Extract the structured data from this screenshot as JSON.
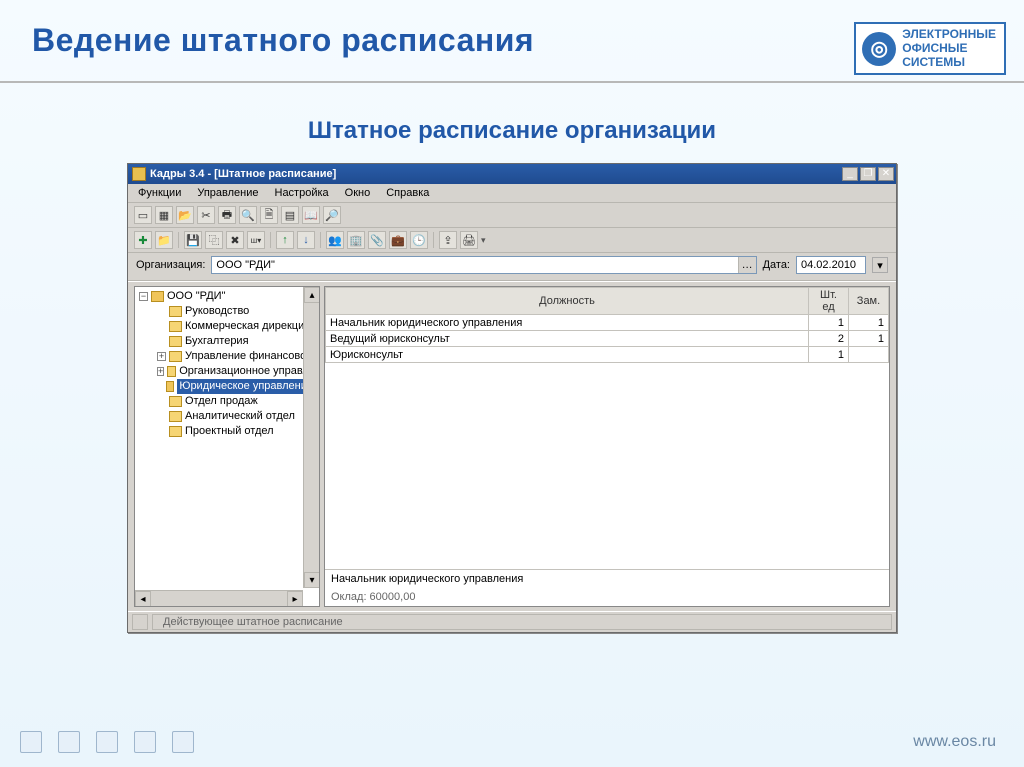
{
  "slide": {
    "title": "Ведение штатного расписания",
    "subtitle": "Штатное расписание организации",
    "logo_lines": [
      "ЭЛЕКТРОННЫЕ",
      "ОФИСНЫЕ",
      "СИСТЕМЫ"
    ],
    "footer_url": "www.eos.ru"
  },
  "window": {
    "title": "Кадры 3.4 - [Штатное расписание]",
    "menu": [
      "Функции",
      "Управление",
      "Настройка",
      "Окно",
      "Справка"
    ],
    "orgrow": {
      "org_label": "Организация:",
      "org_value": "ООО \"РДИ\"",
      "date_label": "Дата:",
      "date_value": "04.02.2010"
    },
    "tree": {
      "root": "ООО \"РДИ\"",
      "children": [
        {
          "label": "Руководство",
          "expand": null
        },
        {
          "label": "Коммерческая дирекция",
          "expand": null
        },
        {
          "label": "Бухгалтерия",
          "expand": null
        },
        {
          "label": "Управление финансовов",
          "expand": "closed"
        },
        {
          "label": "Организационное управле",
          "expand": "closed"
        },
        {
          "label": "Юридическое управление",
          "expand": null,
          "selected": true
        },
        {
          "label": "Отдел продаж",
          "expand": null
        },
        {
          "label": "Аналитический отдел",
          "expand": null
        },
        {
          "label": "Проектный отдел",
          "expand": null
        }
      ]
    },
    "table": {
      "headers": {
        "position": "Должность",
        "units": "Шт. ед",
        "subs": "Зам."
      },
      "rows": [
        {
          "position": "Начальник юридического управления",
          "units": "1",
          "subs": "1"
        },
        {
          "position": "Ведущий юрисконсульт",
          "units": "2",
          "subs": "1"
        },
        {
          "position": "Юрисконсульт",
          "units": "1",
          "subs": ""
        }
      ]
    },
    "detail": {
      "line1": "Начальник юридического управления",
      "line2": "Оклад: 60000,00"
    },
    "status": "Действующее штатное расписание"
  }
}
